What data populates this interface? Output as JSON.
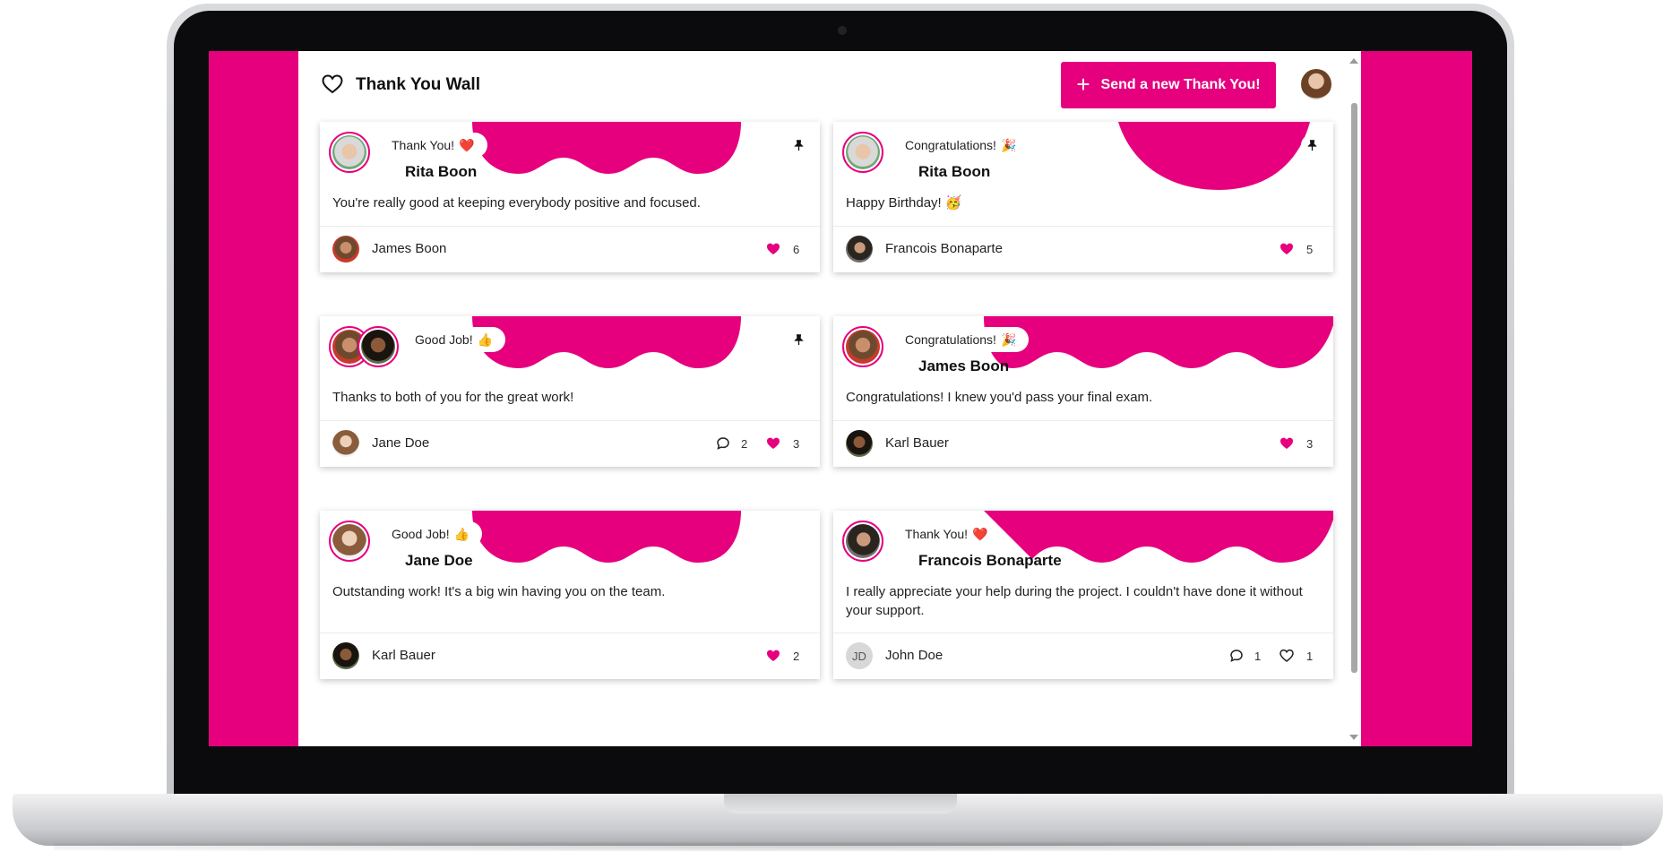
{
  "app": {
    "title": "Thank You Wall",
    "send_button_label": "Send a new Thank You!"
  },
  "colors": {
    "accent": "#e6007e",
    "card_bg": "#ffffff",
    "frame": "#0b0b0d"
  },
  "cards": [
    {
      "category": "Thank You!",
      "category_emoji": "❤️",
      "recipient": "Rita Boon",
      "message": "You're really good at keeping everybody positive and focused.",
      "sender": "James Boon",
      "likes": "6",
      "pinned": true
    },
    {
      "category": "Congratulations!",
      "category_emoji": "🎉",
      "recipient": "Rita Boon",
      "message": "Happy Birthday! 🥳",
      "sender": "Francois Bonaparte",
      "likes": "5",
      "pinned": true
    },
    {
      "category": "Good Job!",
      "category_emoji": "👍",
      "message": "Thanks to both of you for the great work!",
      "sender": "Jane Doe",
      "comments": "2",
      "likes": "3",
      "pinned": true
    },
    {
      "category": "Congratulations!",
      "category_emoji": "🎉",
      "recipient": "James Boon",
      "message": "Congratulations! I knew you'd pass your final exam.",
      "sender": "Karl Bauer",
      "likes": "3"
    },
    {
      "category": "Good Job!",
      "category_emoji": "👍",
      "recipient": "Jane Doe",
      "message": "Outstanding work! It's a big win having you on the team.",
      "sender": "Karl Bauer",
      "likes": "2"
    },
    {
      "category": "Thank You!",
      "category_emoji": "❤️",
      "recipient": "Francois Bonaparte",
      "message": "I really appreciate your help during the project. I couldn't have done it without your support.",
      "sender": "John Doe",
      "sender_initials": "JD",
      "comments": "1",
      "likes": "1"
    }
  ],
  "icons": {
    "header": "heart-outline-icon",
    "send": "plus-icon",
    "pin": "pin-icon",
    "like": "heart-icon",
    "comment": "comment-icon"
  }
}
